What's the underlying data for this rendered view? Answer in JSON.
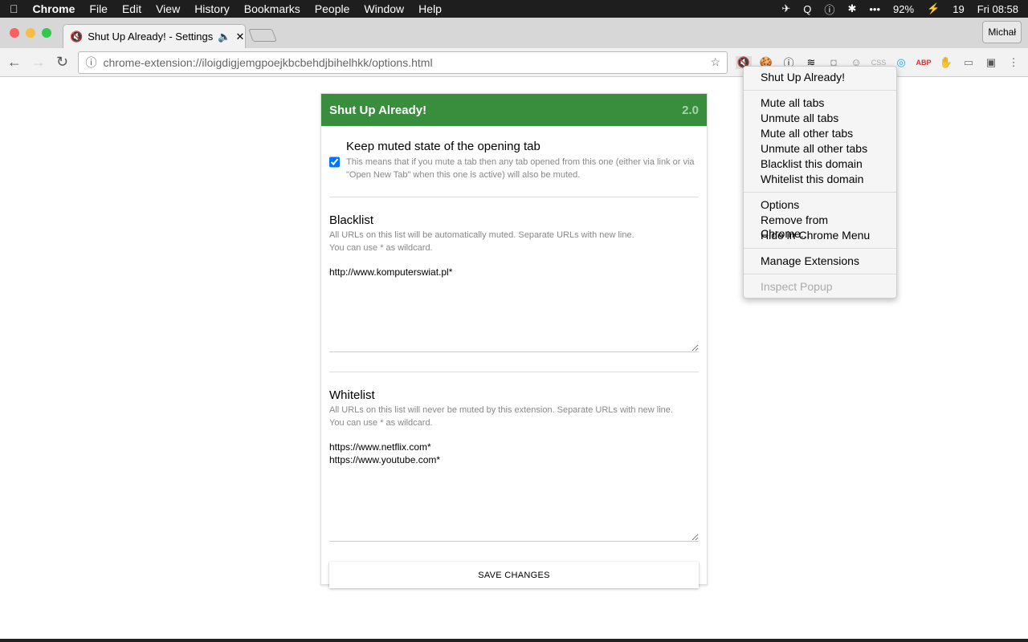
{
  "menubar": {
    "apple": "",
    "app": "Chrome",
    "items": [
      "File",
      "Edit",
      "View",
      "History",
      "Bookmarks",
      "People",
      "Window",
      "Help"
    ],
    "battery": "92%",
    "calendar": "19",
    "clock": "Fri 08:58",
    "dots": "•••"
  },
  "tab": {
    "title": "Shut Up Already! - Settings"
  },
  "profile": "Michał",
  "url": "chrome-extension://iloigdigjemgpoejkbcbehdjbihelhkk/options.html",
  "extensions": [
    "shut-up-already",
    "cookie",
    "onepassword",
    "buffer",
    "camera",
    "ghost",
    "css",
    "quick",
    "ABP",
    "adblock",
    "cast",
    "tab-manager"
  ],
  "card": {
    "title": "Shut Up Already!",
    "version": "2.0",
    "keep_label": "Keep muted state of the opening tab",
    "keep_checked": true,
    "keep_desc": "This means that if you mute a tab then any tab opened from this one (either via link or via \"Open New Tab\" when this one is active) will also be muted.",
    "blacklist": {
      "title": "Blacklist",
      "desc1": "All URLs on this list will be automatically muted. Separate URLs with new line.",
      "desc2": "You can use * as wildcard.",
      "value": "http://www.komputerswiat.pl*"
    },
    "whitelist": {
      "title": "Whitelist",
      "desc1": "All URLs on this list will never be muted by this extension. Separate URLs with new line.",
      "desc2": "You can use * as wildcard.",
      "value": "https://www.netflix.com*\nhttps://www.youtube.com*"
    },
    "save": "SAVE CHANGES"
  },
  "context_menu": {
    "groups": [
      [
        "Shut Up Already!"
      ],
      [
        "Mute all tabs",
        "Unmute all tabs",
        "Mute all other tabs",
        "Unmute all other tabs",
        "Blacklist this domain",
        "Whitelist this domain"
      ],
      [
        "Options",
        "Remove from Chrome...",
        "Hide in Chrome Menu"
      ],
      [
        "Manage Extensions"
      ]
    ],
    "disabled": "Inspect Popup"
  },
  "colors": {
    "header": "#388e3c",
    "accent": "#1a73e8"
  }
}
